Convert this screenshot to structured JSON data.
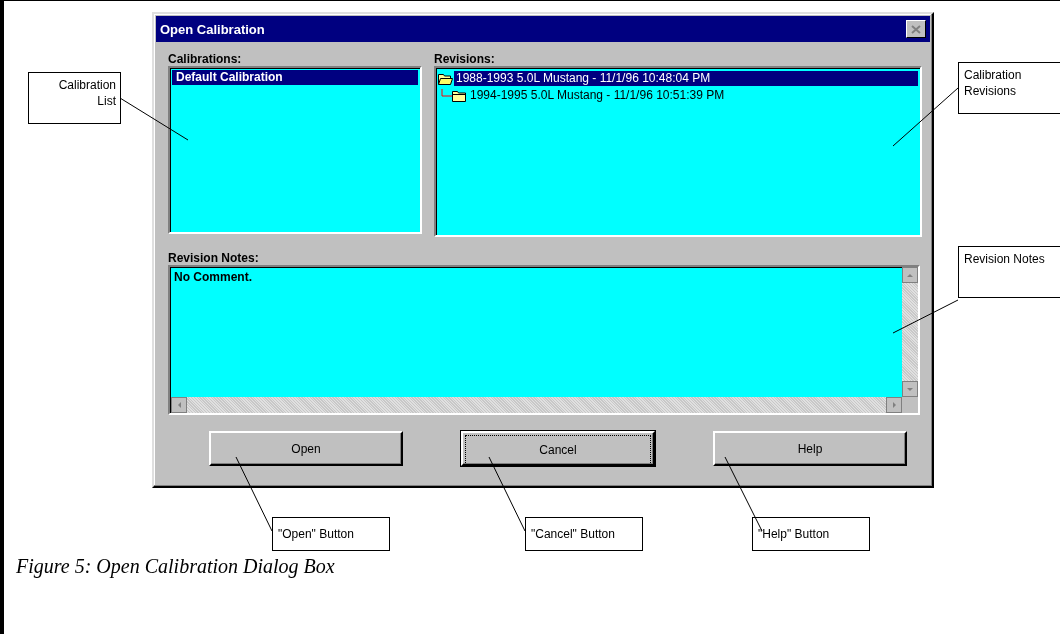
{
  "window": {
    "title": "Open Calibration"
  },
  "calibrations": {
    "label": "Calibrations:",
    "items": [
      {
        "text": "Default Calibration",
        "selected": true
      }
    ]
  },
  "revisions": {
    "label": "Revisions:",
    "items": [
      {
        "text": "1988-1993 5.0L Mustang - 11/1/96 10:48:04 PM",
        "selected": true,
        "expanded": true,
        "children": [
          {
            "text": "1994-1995 5.0L Mustang - 11/1/96 10:51:39 PM",
            "selected": false,
            "expanded": false
          }
        ]
      }
    ]
  },
  "revision_notes": {
    "label": "Revision Notes:",
    "value": "No Comment."
  },
  "buttons": [
    {
      "label": "Open",
      "default": false
    },
    {
      "label": "Cancel",
      "default": true
    },
    {
      "label": "Help",
      "default": false
    }
  ],
  "callouts": [
    {
      "text": "Calibration List"
    },
    {
      "text": "Calibration Revisions"
    },
    {
      "text": "Revision Notes"
    },
    {
      "text": "\"Open\" Button"
    },
    {
      "text": "\"Cancel\" Button"
    },
    {
      "text": "\"Help\" Button"
    }
  ],
  "caption": "Figure 5: Open Calibration Dialog Box"
}
